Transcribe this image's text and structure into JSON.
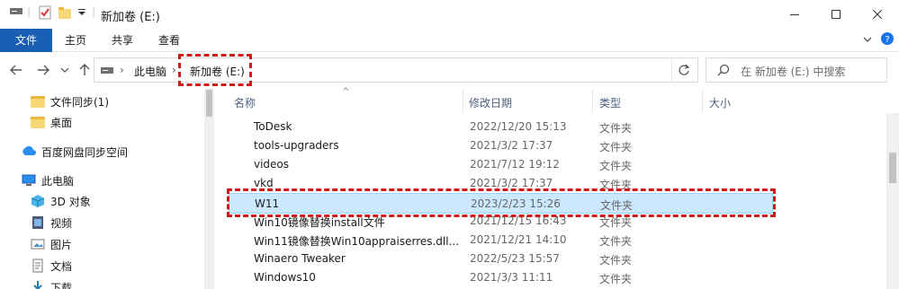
{
  "window": {
    "title": "新加卷 (E:)",
    "min_icon": "minimize-icon",
    "max_icon": "maximize-icon",
    "close_icon": "close-icon"
  },
  "ribbon": {
    "tabs": [
      "文件",
      "主页",
      "共享",
      "查看"
    ]
  },
  "address": {
    "crumbs": [
      "此电脑",
      "新加卷 (E:)"
    ]
  },
  "search": {
    "placeholder": "在 新加卷 (E:) 中搜索"
  },
  "nav": {
    "items": [
      {
        "label": "文件同步(1)",
        "icon": "folder-icon"
      },
      {
        "label": "桌面",
        "icon": "folder-icon"
      },
      {
        "label": "百度网盘同步空间",
        "icon": "baidu-netdisk-icon"
      },
      {
        "label": "此电脑",
        "icon": "computer-icon"
      },
      {
        "label": "3D 对象",
        "icon": "3d-objects-icon"
      },
      {
        "label": "视频",
        "icon": "video-icon"
      },
      {
        "label": "图片",
        "icon": "pictures-icon"
      },
      {
        "label": "文档",
        "icon": "documents-icon"
      },
      {
        "label": "下载",
        "icon": "downloads-icon"
      }
    ]
  },
  "columns": {
    "name": "名称",
    "date": "修改日期",
    "type": "类型",
    "size": "大小"
  },
  "files": [
    {
      "name": "ToDesk",
      "date": "2022/12/20 15:13",
      "type": "文件夹"
    },
    {
      "name": "tools-upgraders",
      "date": "2021/3/2 17:37",
      "type": "文件夹"
    },
    {
      "name": "videos",
      "date": "2021/7/12 19:12",
      "type": "文件夹"
    },
    {
      "name": "vkd",
      "date": "2021/3/2 17:37",
      "type": "文件夹"
    },
    {
      "name": "W11",
      "date": "2023/2/23 15:26",
      "type": "文件夹",
      "selected": true
    },
    {
      "name": "Win10镜像替换install文件",
      "date": "2021/12/15 16:43",
      "type": "文件夹"
    },
    {
      "name": "Win11镜像替换Win10appraiserres.dll...",
      "date": "2021/12/21 14:10",
      "type": "文件夹"
    },
    {
      "name": "Winaero Tweaker",
      "date": "2022/5/23 15:57",
      "type": "文件夹"
    },
    {
      "name": "Windows10",
      "date": "2021/3/3 11:11",
      "type": "文件夹"
    }
  ],
  "colors": {
    "accent": "#1a5fb4",
    "selection": "#cce8ff",
    "highlight": "#d01a1a"
  }
}
